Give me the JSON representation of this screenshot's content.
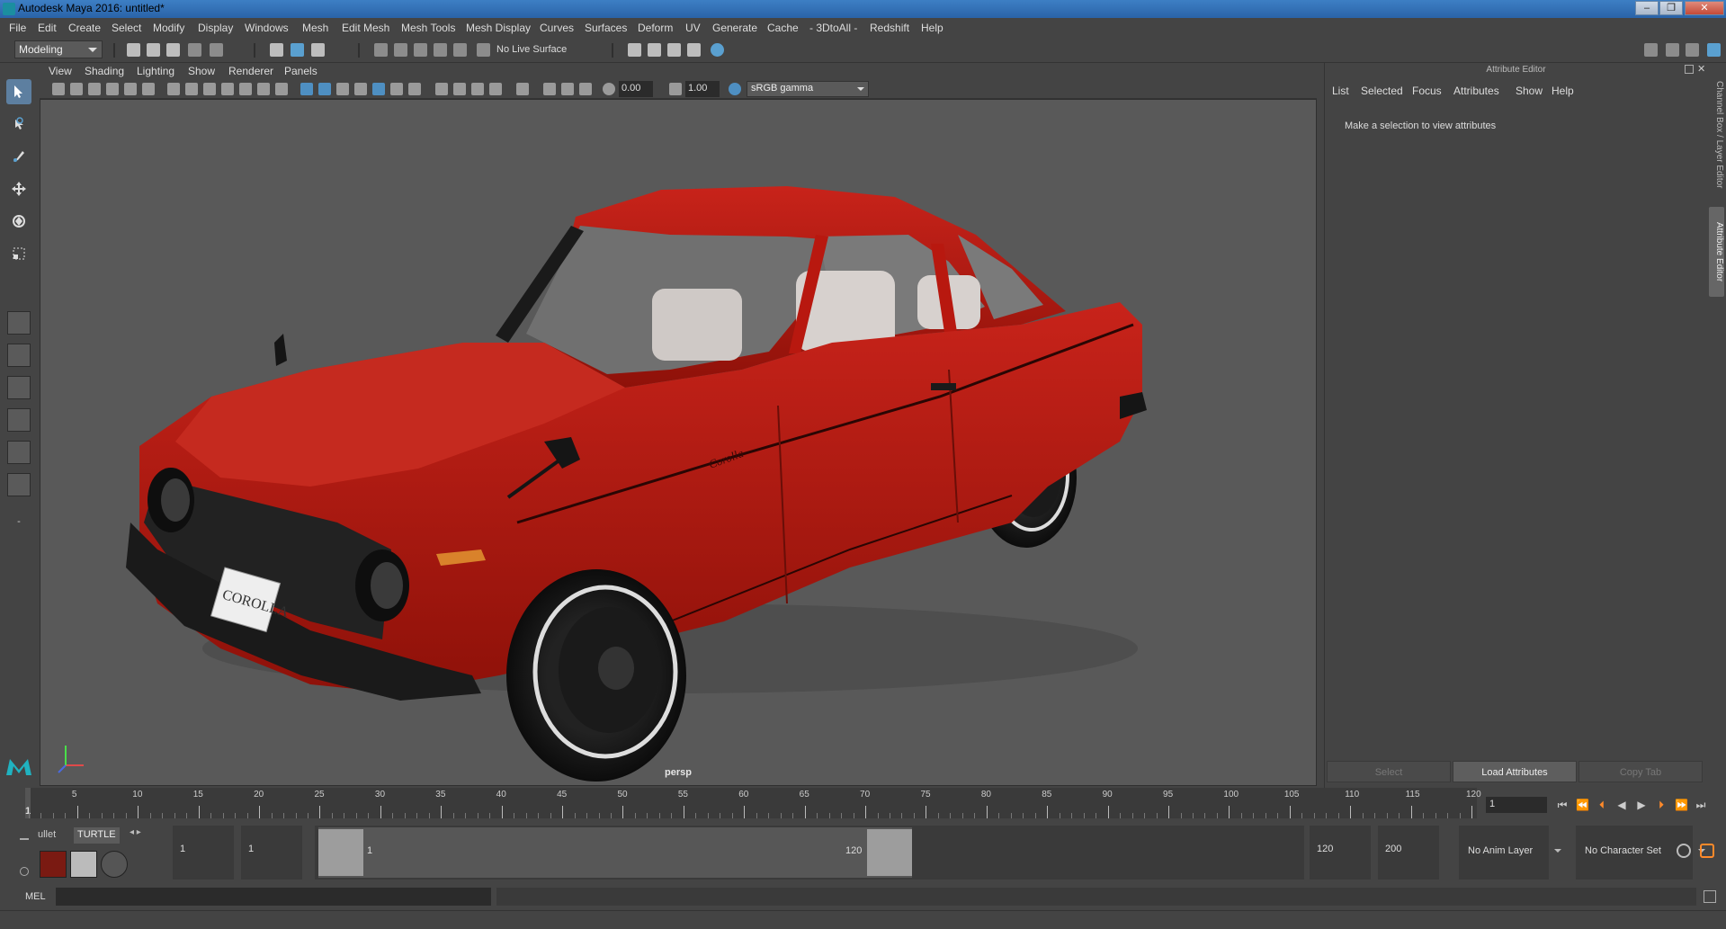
{
  "window": {
    "title": "Autodesk Maya 2016: untitled*",
    "controls": [
      "–",
      "❐",
      "✕"
    ]
  },
  "menubar": [
    "File",
    "Edit",
    "Create",
    "Select",
    "Modify",
    "Display",
    "Windows",
    "Mesh",
    "Edit Mesh",
    "Mesh Tools",
    "Mesh Display",
    "Curves",
    "Surfaces",
    "Deform",
    "UV",
    "Generate",
    "Cache",
    "- 3DtoAll -",
    "Redshift",
    "Help"
  ],
  "statusline": {
    "mode": "Modeling",
    "live_surface": "No Live Surface"
  },
  "viewport": {
    "menus": [
      "View",
      "Shading",
      "Lighting",
      "Show",
      "Renderer",
      "Panels"
    ],
    "exposure": "0.00",
    "gamma": "1.00",
    "color_space": "sRGB gamma",
    "camera_label": "persp",
    "plate_text": "COROLLA",
    "badge_text": "Corolla"
  },
  "attribute_editor": {
    "title": "Attribute Editor",
    "menus": [
      "List",
      "Selected",
      "Focus",
      "Attributes",
      "Show",
      "Help"
    ],
    "message": "Make a selection to view attributes",
    "buttons": {
      "select": "Select",
      "load": "Load Attributes",
      "copy": "Copy Tab"
    }
  },
  "side_tabs": {
    "channel_box": "Channel Box / Layer Editor",
    "attribute_editor": "Attribute Editor"
  },
  "timeline": {
    "ticks": [
      1,
      5,
      10,
      15,
      20,
      25,
      30,
      35,
      40,
      45,
      50,
      55,
      60,
      65,
      70,
      75,
      80,
      85,
      90,
      95,
      100,
      105,
      110,
      115,
      120
    ],
    "current_frame": "1",
    "frame_field": "1"
  },
  "range": {
    "shelf_tabs": [
      "ullet",
      "TURTLE"
    ],
    "start": "1",
    "playback_start": "1",
    "range_start_label": "1",
    "range_end_label": "120",
    "playback_end": "120",
    "end": "200",
    "anim_layer": "No Anim Layer",
    "character_set": "No Character Set"
  },
  "command_line": {
    "label": "MEL"
  },
  "colors": {
    "car_body": "#b8180f",
    "viewport_bg": "#595959",
    "accent": "#5d7fa0"
  }
}
